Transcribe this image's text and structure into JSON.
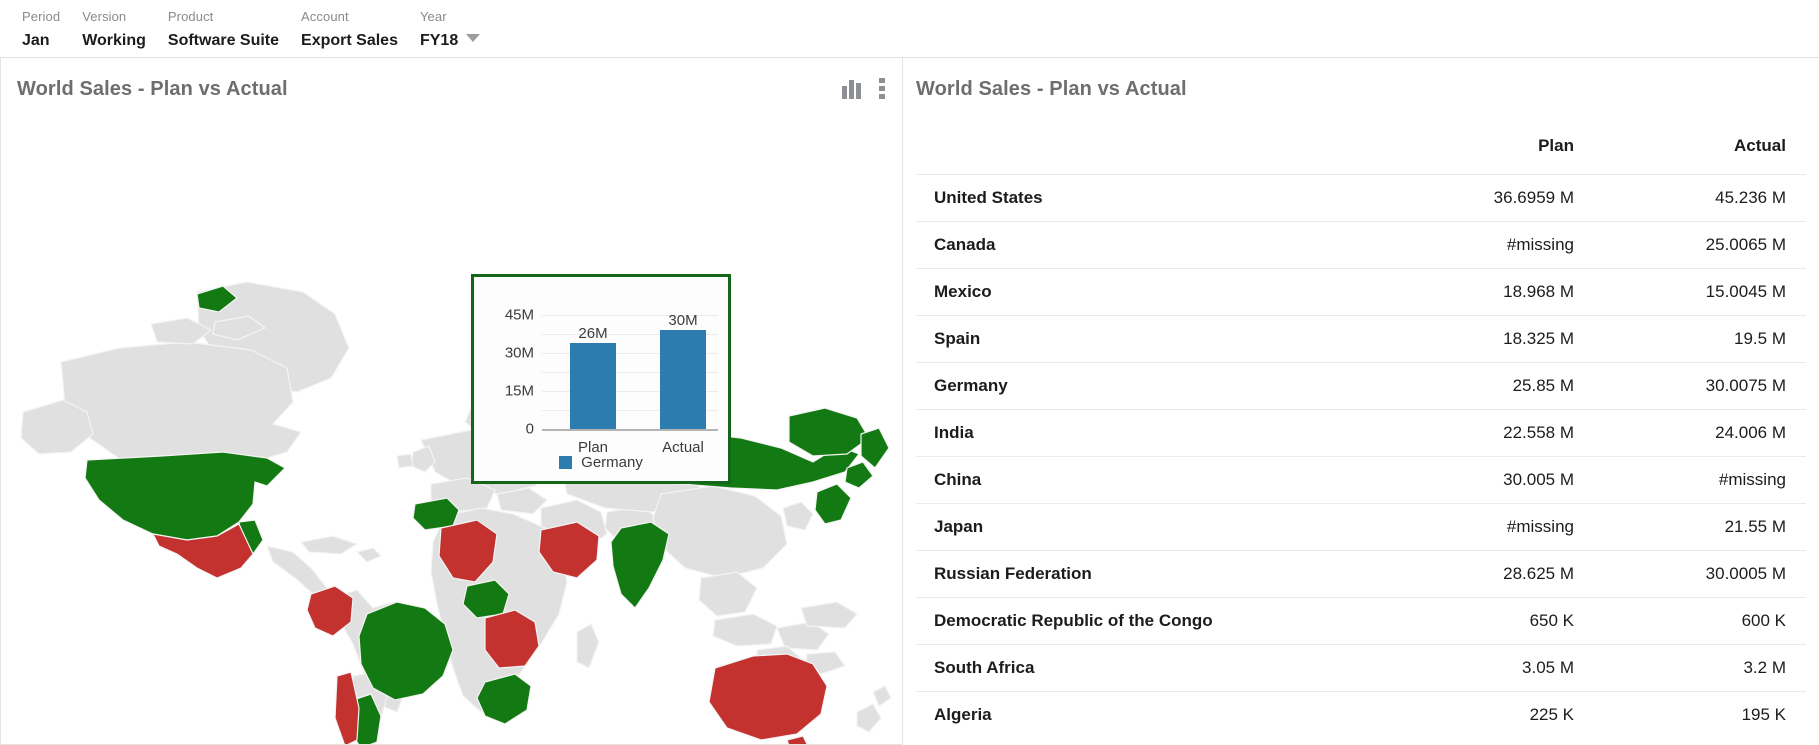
{
  "filters": [
    {
      "label": "Period",
      "value": "Jan",
      "has_caret": false
    },
    {
      "label": "Version",
      "value": "Working",
      "has_caret": false
    },
    {
      "label": "Product",
      "value": "Software Suite",
      "has_caret": false
    },
    {
      "label": "Account",
      "value": "Export Sales",
      "has_caret": false
    },
    {
      "label": "Year",
      "value": "FY18",
      "has_caret": true
    }
  ],
  "map_card": {
    "title": "World Sales - Plan vs Actual",
    "icons": {
      "chart": "bar-chart-icon",
      "menu": "kebab-menu-icon"
    },
    "colors": {
      "green": "#137a13",
      "red": "#c4322f",
      "neutral": "#e0e0e0",
      "ocean": "#ffffff"
    },
    "green_countries": [
      "United States",
      "Brazil",
      "Argentina",
      "Spain",
      "Nigeria",
      "South Africa",
      "Russian Federation",
      "India",
      "Japan",
      "Sweden",
      "Greenland-west"
    ],
    "red_countries": [
      "Mexico",
      "Colombia",
      "Chile",
      "Algeria",
      "Saudi Arabia",
      "Democratic Republic of the Congo",
      "Australia"
    ]
  },
  "tooltip": {
    "legend_label": "Germany",
    "legend_color": "#2d7cb0",
    "border_color": "#14661a"
  },
  "table_card": {
    "title": "World Sales - Plan vs Actual",
    "columns": [
      "",
      "Plan",
      "Actual"
    ],
    "rows": [
      {
        "country": "United States",
        "plan": "36.6959 M",
        "actual": "45.236 M"
      },
      {
        "country": "Canada",
        "plan": "#missing",
        "actual": "25.0065 M"
      },
      {
        "country": "Mexico",
        "plan": "18.968 M",
        "actual": "15.0045 M"
      },
      {
        "country": "Spain",
        "plan": "18.325 M",
        "actual": "19.5 M"
      },
      {
        "country": "Germany",
        "plan": "25.85 M",
        "actual": "30.0075 M"
      },
      {
        "country": "India",
        "plan": "22.558 M",
        "actual": "24.006 M"
      },
      {
        "country": "China",
        "plan": "30.005 M",
        "actual": "#missing"
      },
      {
        "country": "Japan",
        "plan": "#missing",
        "actual": "21.55 M"
      },
      {
        "country": "Russian Federation",
        "plan": "28.625 M",
        "actual": "30.0005 M"
      },
      {
        "country": "Democratic Republic of the Congo",
        "plan": "650 K",
        "actual": "600 K"
      },
      {
        "country": "South Africa",
        "plan": "3.05 M",
        "actual": "3.2 M"
      },
      {
        "country": "Algeria",
        "plan": "225 K",
        "actual": "195 K"
      }
    ]
  },
  "chart_data": {
    "type": "bar",
    "title": "Germany",
    "categories": [
      "Plan",
      "Actual"
    ],
    "values": [
      26000000,
      30000000
    ],
    "data_labels": [
      "26M",
      "30M"
    ],
    "ytick_labels": [
      "0",
      "15M",
      "30M",
      "45M"
    ],
    "ytick_values": [
      0,
      15000000,
      30000000,
      45000000
    ],
    "ylim": [
      0,
      52500000
    ],
    "xlabel": "",
    "ylabel": "",
    "grid": true,
    "legend": [
      "Germany"
    ],
    "legend_position": "bottom",
    "series_color": "#2d7cb0"
  }
}
